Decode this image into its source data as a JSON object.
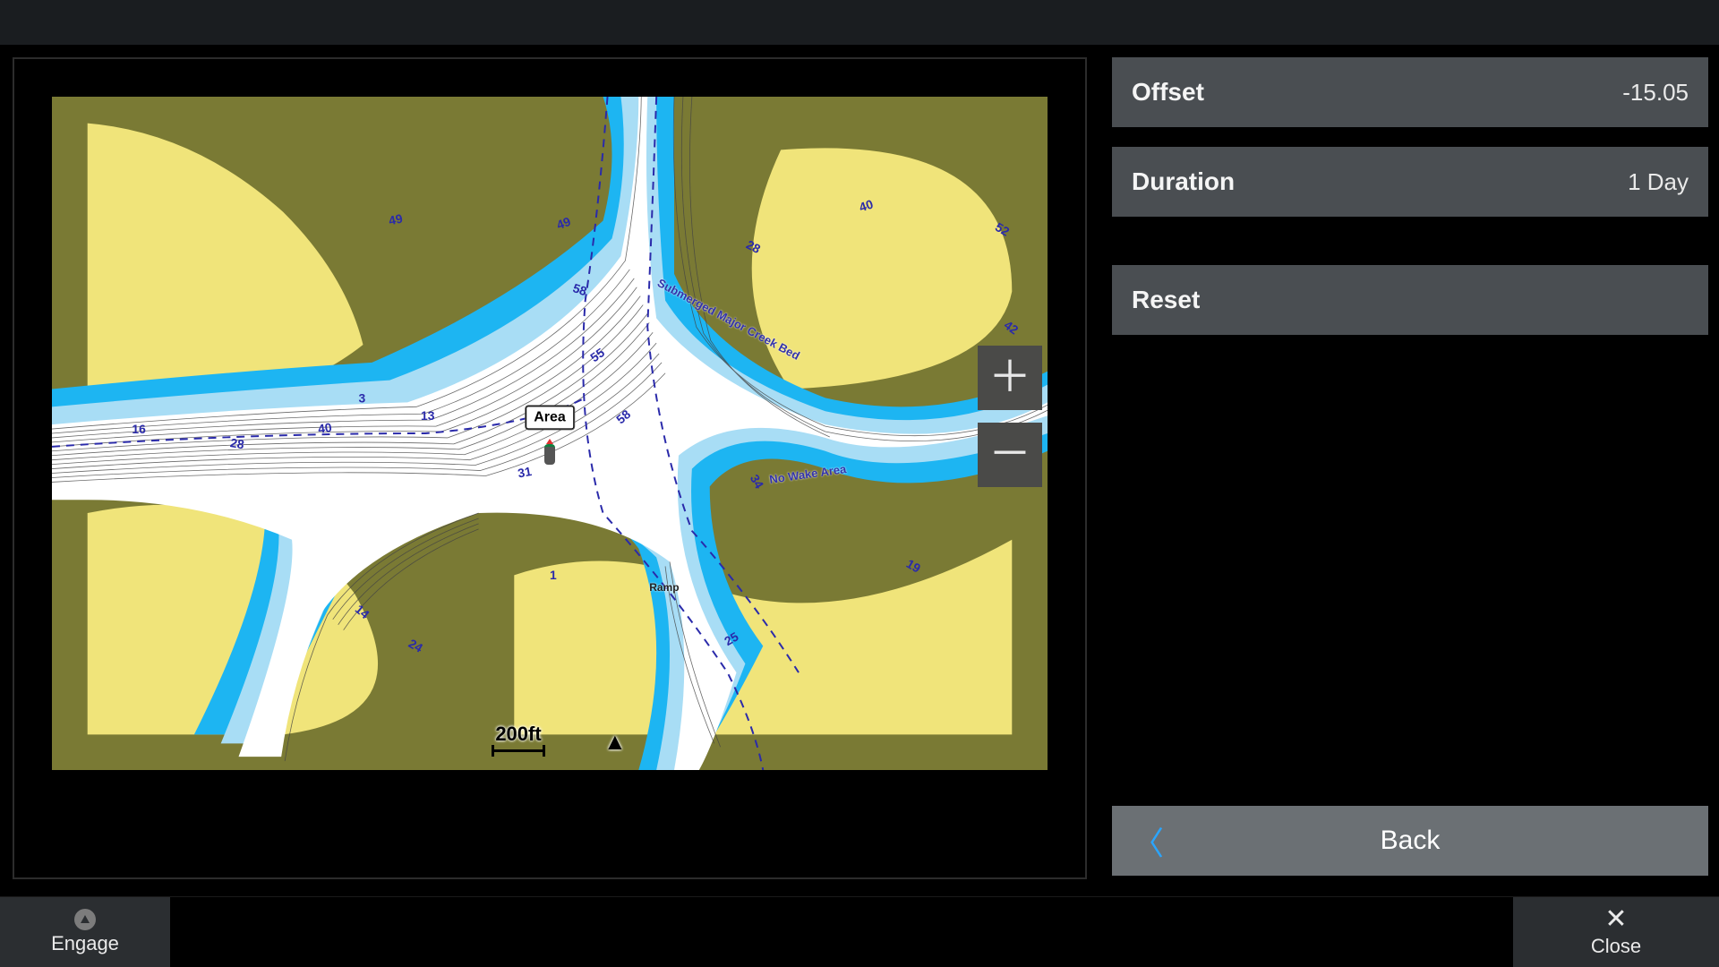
{
  "top": {},
  "chart": {
    "marker_label": "Area",
    "scale_label": "200ft",
    "labels": {
      "creek": "Submerged Major Creek Bed",
      "no_wake": "No Wake Area",
      "ramp": "Ramp"
    },
    "depth_numbers": [
      "49",
      "49",
      "58",
      "55",
      "58",
      "28",
      "40",
      "52",
      "42",
      "16",
      "28",
      "40",
      "3",
      "13",
      "31",
      "34",
      "25",
      "19",
      "1",
      "14",
      "24"
    ],
    "zoom": {
      "in": "＋",
      "out": "－"
    }
  },
  "sidebar": {
    "offset": {
      "label": "Offset",
      "value": "-15.05"
    },
    "duration": {
      "label": "Duration",
      "value": "1 Day"
    },
    "reset": {
      "label": "Reset"
    },
    "back": {
      "label": "Back"
    }
  },
  "bottom": {
    "engage": "Engage",
    "close": "Close"
  }
}
